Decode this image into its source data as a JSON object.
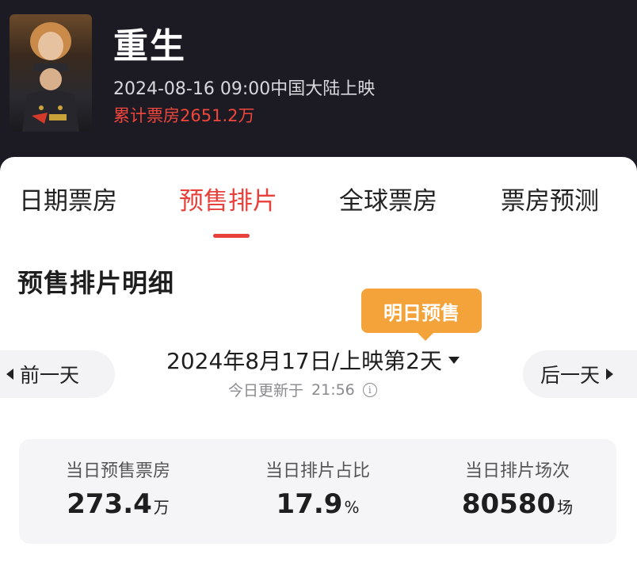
{
  "movie": {
    "title": "重生",
    "release": "2024-08-16 09:00中国大陆上映",
    "box_office_total": "累计票房2651.2万",
    "poster_icon": "movie-poster"
  },
  "tabs": [
    {
      "label": "日期票房",
      "active": false
    },
    {
      "label": "预售排片",
      "active": true
    },
    {
      "label": "全球票房",
      "active": false
    },
    {
      "label": "票房预测",
      "active": false
    }
  ],
  "section": {
    "title": "预售排片明细",
    "badge": "明日预售"
  },
  "date_nav": {
    "prev_label": "前一天",
    "next_label": "后一天",
    "selected_date": "2024年8月17日/上映第2天",
    "update_label": "今日更新于",
    "update_time": "21:56"
  },
  "stats": [
    {
      "label": "当日预售票房",
      "value": "273.4",
      "unit": "万"
    },
    {
      "label": "当日排片占比",
      "value": "17.9",
      "unit": "%"
    },
    {
      "label": "当日排片场次",
      "value": "80580",
      "unit": "场"
    }
  ],
  "colors": {
    "accent": "#e8403a",
    "badge": "#f3a33a",
    "header_bg": "#1c1b24"
  }
}
